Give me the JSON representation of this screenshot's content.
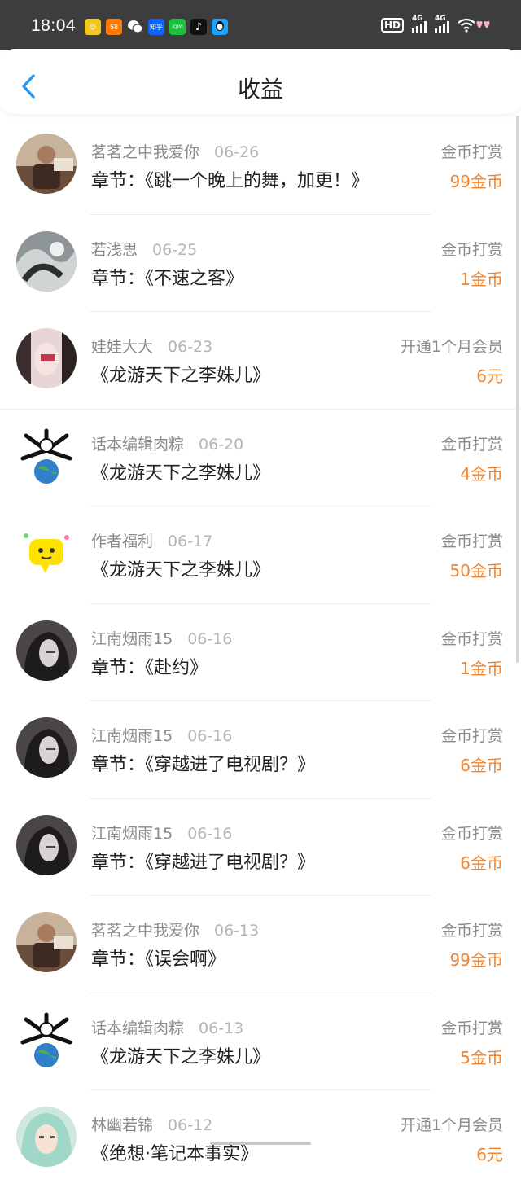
{
  "status_bar": {
    "time": "18:04",
    "apps": [
      {
        "icon": "app-smile-icon",
        "label": "",
        "color": "#f3c623"
      },
      {
        "icon": "app-58-icon",
        "label": "58",
        "color": "#ff7a00"
      },
      {
        "icon": "wechat-icon",
        "label": "",
        "color": "#3d3d3d"
      },
      {
        "icon": "zhihu-icon",
        "label": "知乎",
        "color": "#0b66ff"
      },
      {
        "icon": "iqiyi-icon",
        "label": "iQIYI",
        "color": "#19c23a"
      },
      {
        "icon": "tiktok-icon",
        "label": "♪",
        "color": "#111111"
      },
      {
        "icon": "qq-icon",
        "label": "",
        "color": "#1aa3ff"
      }
    ],
    "hd_label": "HD",
    "signal1_label": "4G",
    "signal2_label": "4G"
  },
  "header": {
    "title": "收益"
  },
  "colors": {
    "accent": "#2196f3",
    "amount": "#ef8431",
    "muted": "#8a8a8a"
  },
  "items": [
    {
      "avatar": "avatar-man-reading",
      "name": "茗茗之中我爱你",
      "date": "06-26",
      "type": "金币打赏",
      "content": "章节：《跳一个晚上的舞，加更！》",
      "amount": "99金币"
    },
    {
      "avatar": "avatar-ink-art",
      "name": "若浅思",
      "date": "06-25",
      "type": "金币打赏",
      "content": "章节：《不速之客》",
      "amount": "1金币"
    },
    {
      "avatar": "avatar-girl-mask",
      "name": "娃娃大大",
      "date": "06-23",
      "type": "开通1个月会员",
      "content": "《龙游天下之李姝儿》",
      "amount": "6元"
    },
    {
      "avatar": "avatar-globe-bones",
      "name": "话本编辑肉粽",
      "date": "06-20",
      "type": "金币打赏",
      "content": "《龙游天下之李姝儿》",
      "amount": "4金币"
    },
    {
      "avatar": "avatar-yellow-chat",
      "name": "作者福利",
      "date": "06-17",
      "type": "金币打赏",
      "content": "《龙游天下之李姝儿》",
      "amount": "50金币"
    },
    {
      "avatar": "avatar-dark-lady",
      "name": "江南烟雨15",
      "date": "06-16",
      "type": "金币打赏",
      "content": "章节：《赴约》",
      "amount": "1金币"
    },
    {
      "avatar": "avatar-dark-lady",
      "name": "江南烟雨15",
      "date": "06-16",
      "type": "金币打赏",
      "content": "章节：《穿越进了电视剧？》",
      "amount": "6金币"
    },
    {
      "avatar": "avatar-dark-lady",
      "name": "江南烟雨15",
      "date": "06-16",
      "type": "金币打赏",
      "content": "章节：《穿越进了电视剧？》",
      "amount": "6金币"
    },
    {
      "avatar": "avatar-man-reading",
      "name": "茗茗之中我爱你",
      "date": "06-13",
      "type": "金币打赏",
      "content": "章节：《误会啊》",
      "amount": "99金币"
    },
    {
      "avatar": "avatar-globe-bones",
      "name": "话本编辑肉粽",
      "date": "06-13",
      "type": "金币打赏",
      "content": "《龙游天下之李姝儿》",
      "amount": "5金币"
    },
    {
      "avatar": "avatar-elf-girl",
      "name": "林幽若锦",
      "date": "06-12",
      "type": "开通1个月会员",
      "content": "《绝想·笔记本事实》",
      "amount": "6元"
    }
  ]
}
